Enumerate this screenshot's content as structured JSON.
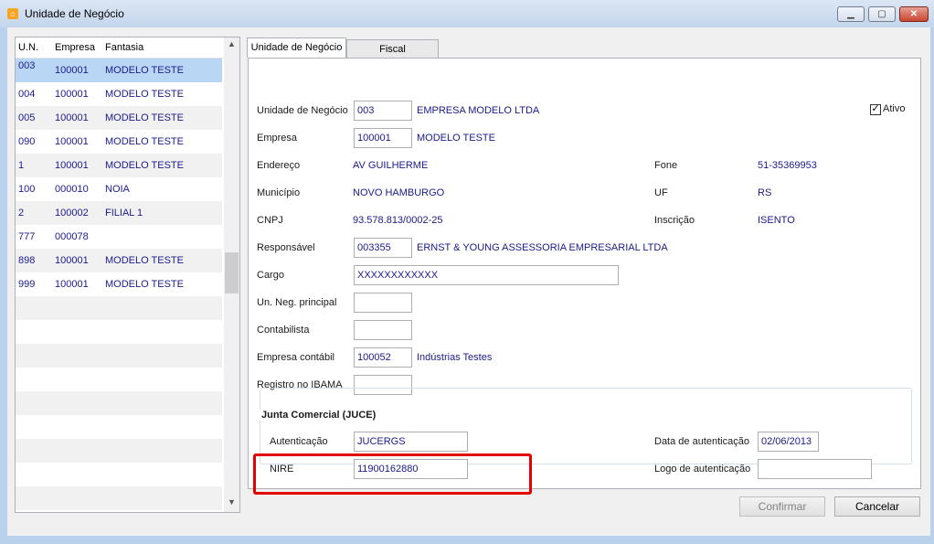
{
  "window": {
    "title": "Unidade de Negócio",
    "app_icon": "house-icon",
    "controls": [
      "minimize-icon",
      "maximize-icon",
      "close-icon"
    ]
  },
  "list": {
    "columns": [
      "U.N.",
      "Empresa",
      "Fantasia"
    ],
    "rows": [
      {
        "un": "003",
        "empresa": "100001",
        "fantasia": "MODELO TESTE"
      },
      {
        "un": "004",
        "empresa": "100001",
        "fantasia": "MODELO TESTE"
      },
      {
        "un": "005",
        "empresa": "100001",
        "fantasia": "MODELO TESTE"
      },
      {
        "un": "090",
        "empresa": "100001",
        "fantasia": "MODELO TESTE"
      },
      {
        "un": "1",
        "empresa": "100001",
        "fantasia": "MODELO TESTE"
      },
      {
        "un": "100",
        "empresa": "000010",
        "fantasia": "NOIA"
      },
      {
        "un": "2",
        "empresa": "100002",
        "fantasia": "FILIAL 1"
      },
      {
        "un": "777",
        "empresa": "000078",
        "fantasia": ""
      },
      {
        "un": "898",
        "empresa": "100001",
        "fantasia": "MODELO TESTE"
      },
      {
        "un": "999",
        "empresa": "100001",
        "fantasia": "MODELO TESTE"
      }
    ]
  },
  "tabs": [
    "Unidade de Negócio",
    "Fiscal"
  ],
  "form": {
    "ativo_label": "Ativo",
    "un_label": "Unidade de Negócio",
    "un_value": "003",
    "un_name": "EMPRESA MODELO LTDA",
    "empresa_label": "Empresa",
    "empresa_value": "100001",
    "empresa_name": "MODELO TESTE",
    "endereco_label": "Endereço",
    "endereco_value": "AV GUILHERME",
    "fone_label": "Fone",
    "fone_value": "51-35369953",
    "municipio_label": "Município",
    "municipio_value": "NOVO HAMBURGO",
    "uf_label": "UF",
    "uf_value": "RS",
    "cnpj_label": "CNPJ",
    "cnpj_value": "93.578.813/0002-25",
    "inscricao_label": "Inscrição",
    "inscricao_value": "ISENTO",
    "responsavel_label": "Responsável",
    "responsavel_value": "003355",
    "responsavel_name": "ERNST & YOUNG ASSESSORIA EMPRESARIAL LTDA",
    "cargo_label": "Cargo",
    "cargo_value": "XXXXXXXXXXXX",
    "unneg_label": "Un. Neg. principal",
    "unneg_value": "",
    "contabilista_label": "Contabilista",
    "contabilista_value": "",
    "empcontabil_label": "Empresa contábil",
    "empcontabil_value": "100052",
    "empcontabil_name": "Indústrias Testes",
    "ibama_label": "Registro no IBAMA",
    "ibama_value": ""
  },
  "juce": {
    "title": "Junta Comercial (JUCE)",
    "autenticacao_label": "Autenticação",
    "autenticacao_value": "JUCERGS",
    "data_label": "Data de autenticação",
    "data_value": "02/06/2013",
    "nire_label": "NIRE",
    "nire_value": "11900162880",
    "logo_label": "Logo de autenticação",
    "logo_value": ""
  },
  "buttons": {
    "confirmar": "Confirmar",
    "cancelar": "Cancelar"
  }
}
